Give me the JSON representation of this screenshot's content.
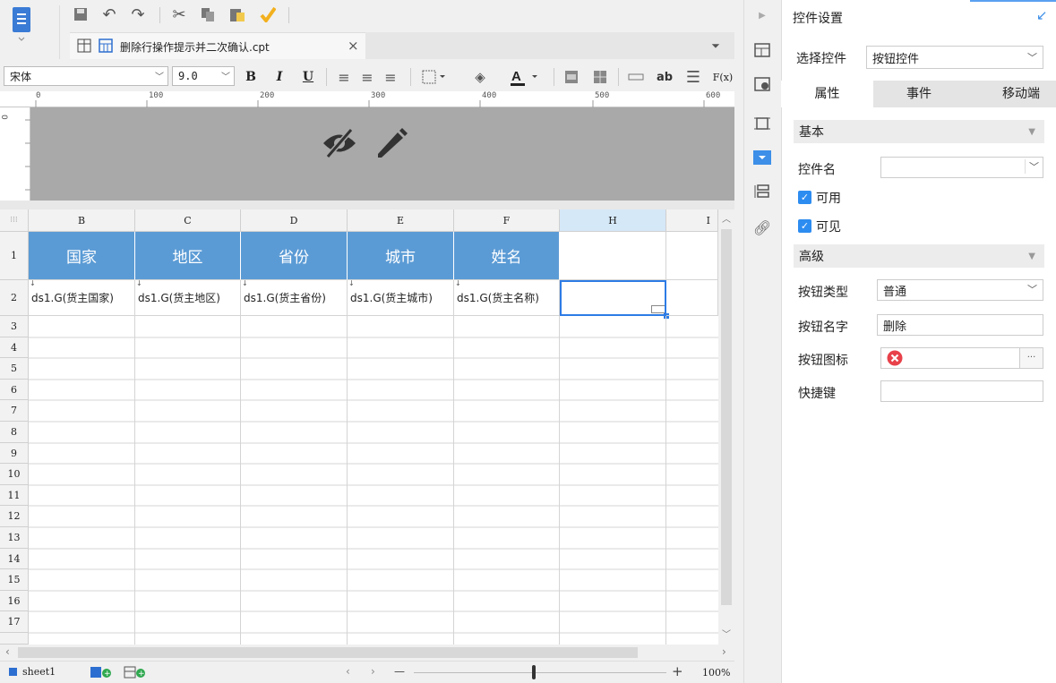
{
  "toolbar": {
    "font_name": "宋体",
    "font_size": "9.0",
    "bold": "B",
    "italic": "I",
    "underline": "U",
    "ab": "ab",
    "fx": "F(x)"
  },
  "tab": {
    "title": "删除行操作提示并二次确认.cpt",
    "close": "×"
  },
  "ruler": {
    "marks": [
      "0",
      "100",
      "200",
      "300",
      "400",
      "500",
      "600"
    ]
  },
  "grid": {
    "columns": [
      "B",
      "C",
      "D",
      "E",
      "F",
      "H",
      "I"
    ],
    "rows": [
      "1",
      "2",
      "3",
      "4",
      "5",
      "6",
      "7",
      "8",
      "9",
      "10",
      "11",
      "12",
      "13",
      "14",
      "15",
      "16",
      "17"
    ],
    "header_cells": [
      "国家",
      "地区",
      "省份",
      "城市",
      "姓名"
    ],
    "data_cells": [
      "ds1.G(货主国家)",
      "ds1.G(货主地区)",
      "ds1.G(货主省份)",
      "ds1.G(货主城市)",
      "ds1.G(货主名称)"
    ],
    "header_color": "#5b9bd5",
    "selected_color": "#2d7be5"
  },
  "status": {
    "sheet": "sheet1",
    "zoom": "100%",
    "zoom_minus": "—",
    "zoom_plus": "+"
  },
  "panel": {
    "title": "控件设置",
    "select_label": "选择控件",
    "select_value": "按钮控件",
    "tabs": [
      "属性",
      "事件",
      "移动端"
    ],
    "section_basic": "基本",
    "widget_name_label": "控件名",
    "widget_name_value": "",
    "enabled_label": "可用",
    "visible_label": "可见",
    "section_advanced": "高级",
    "button_type_label": "按钮类型",
    "button_type_value": "普通",
    "button_name_label": "按钮名字",
    "button_name_value": "删除",
    "button_icon_label": "按钮图标",
    "button_icon_more": "···",
    "shortcut_label": "快捷键",
    "shortcut_value": ""
  }
}
